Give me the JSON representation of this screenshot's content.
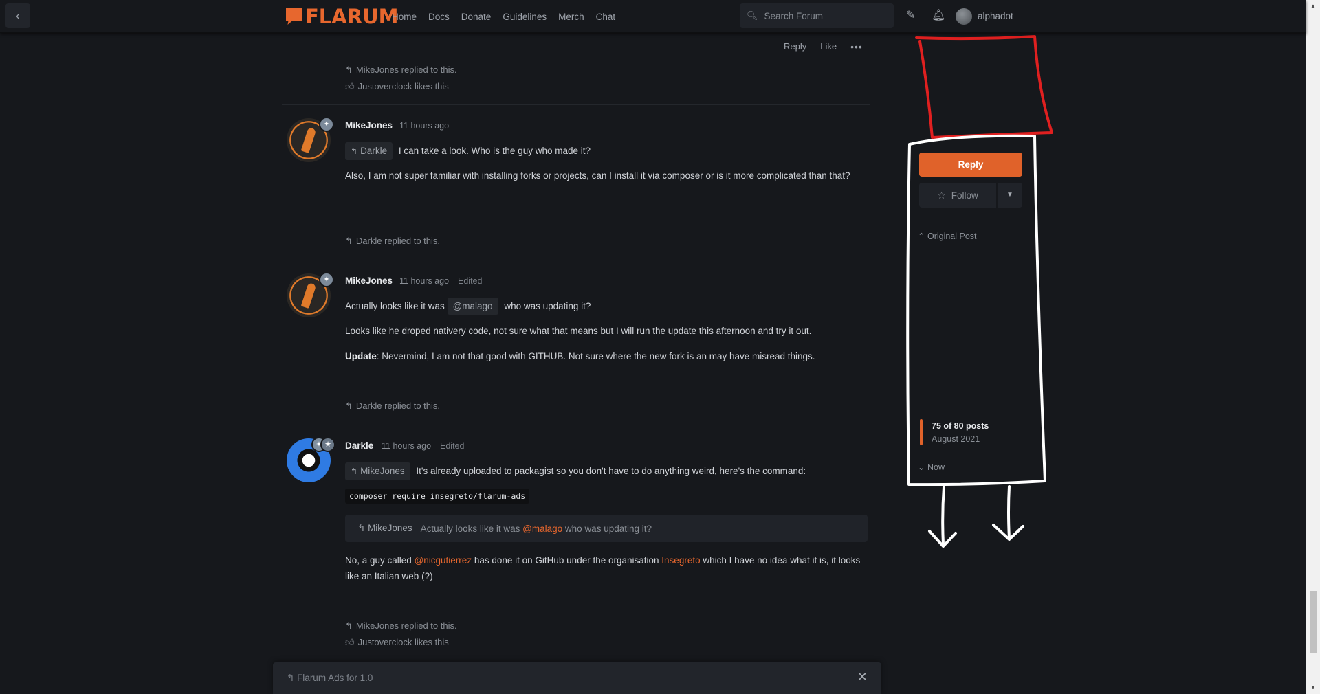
{
  "header": {
    "logo_text": "FLARUM",
    "nav": [
      "Home",
      "Docs",
      "Donate",
      "Guidelines",
      "Merch",
      "Chat"
    ],
    "search_placeholder": "Search Forum",
    "username": "alphadot"
  },
  "post_actions": {
    "reply": "Reply",
    "like": "Like",
    "more": "•••"
  },
  "top_footer": {
    "replied": "MikeJones replied to this.",
    "likes": "Justoverclock likes this"
  },
  "posts": [
    {
      "author": "MikeJones",
      "time": "11 hours ago",
      "reply_to": "Darkle",
      "line1": "I can take a look. Who is the guy who made it?",
      "line2": "Also, I am not super familiar with installing forks or projects, can I install it via composer or is it more complicated than that?",
      "footer": "Darkle replied to this."
    },
    {
      "author": "MikeJones",
      "time": "11 hours ago",
      "edited": "Edited",
      "line1_a": "Actually looks like it was",
      "mention": "@malago",
      "line1_b": "who was updating it?",
      "line2": "Looks like he droped nativery code, not sure what that means but I will run the update this afternoon and try it out.",
      "line3_bold": "Update",
      "line3": ": Nevermind, I am not that good with GITHUB. Not sure where the new fork is an may have misread things.",
      "footer": "Darkle replied to this."
    },
    {
      "author": "Darkle",
      "time": "11 hours ago",
      "edited": "Edited",
      "reply_to": "MikeJones",
      "line1": "It's already uploaded to packagist so you don't have to do anything weird, here's the command:",
      "code": "composer require insegreto/flarum-ads",
      "quote_author": "MikeJones",
      "quote_a": "Actually looks like it was",
      "quote_mention": "@malago",
      "quote_b": "who was updating it?",
      "text_a": "No, a guy called",
      "mention1": "@nicgutierrez",
      "text_b": "has done it on GitHub under the organisation",
      "mention2": "Insegreto",
      "text_c": "which I have no idea what it is, it looks like an Italian web (?)",
      "footer_replied": "MikeJones replied to this.",
      "footer_likes": "Justoverclock likes this"
    }
  ],
  "composer": {
    "title": "Flarum Ads for 1.0",
    "close": "✕"
  },
  "sidebar": {
    "reply": "Reply",
    "follow": "Follow",
    "original_post": "Original Post",
    "count": "75 of 80 posts",
    "date": "August 2021",
    "now": "Now"
  },
  "colors": {
    "accent": "#e0622a",
    "background": "#16181c",
    "annotation_red": "#e02020",
    "annotation_white": "#ffffff"
  }
}
